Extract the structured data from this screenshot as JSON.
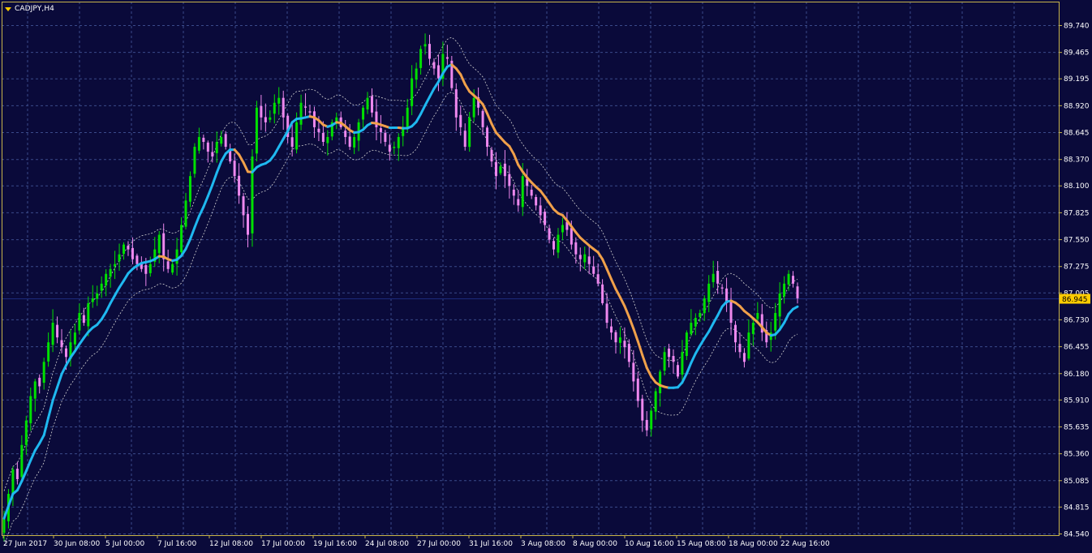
{
  "window": {
    "title": "CADJPY,H4",
    "menu_icon": "triangle-down-icon"
  },
  "colors": {
    "background": "#0a0a3a",
    "frame": "#c8b44a",
    "grid": "#3a4a8a",
    "text": "#ffffff",
    "bull_candle": "#00e000",
    "bear_candle": "#ee88ee",
    "ma_up": "#1fb8f0",
    "ma_down": "#f0a04a",
    "bands": "#d0d0d0",
    "price_line": "#1c2a7a",
    "price_tag_bg": "#ffcc00",
    "price_tag_text": "#000000"
  },
  "chart_data": {
    "type": "candlestick",
    "symbol": "CADJPY",
    "timeframe": "H4",
    "ylim": [
      84.54,
      89.74
    ],
    "y_ticks": [
      "89.740",
      "89.465",
      "89.195",
      "88.920",
      "88.645",
      "88.370",
      "88.100",
      "87.825",
      "87.550",
      "87.275",
      "87.005",
      "86.730",
      "86.455",
      "86.180",
      "85.910",
      "85.635",
      "85.360",
      "85.085",
      "84.815",
      "84.540"
    ],
    "x_ticks": [
      "27 Jun 2017",
      "30 Jun 08:00",
      "5 Jul 00:00",
      "7 Jul 16:00",
      "12 Jul 08:00",
      "17 Jul 00:00",
      "19 Jul 16:00",
      "24 Jul 08:00",
      "27 Jul 00:00",
      "31 Jul 16:00",
      "3 Aug 08:00",
      "8 Aug 00:00",
      "10 Aug 16:00",
      "15 Aug 08:00",
      "18 Aug 00:00",
      "22 Aug 16:00"
    ],
    "current_price": "86.945",
    "grid": true,
    "indicators": [
      "moving average (two-color)",
      "envelope bands (dotted)"
    ],
    "closes": [
      84.7,
      84.95,
      85.2,
      85.1,
      85.45,
      85.7,
      85.95,
      86.1,
      86.05,
      86.3,
      86.5,
      86.7,
      86.55,
      86.45,
      86.35,
      86.5,
      86.6,
      86.8,
      86.7,
      86.9,
      86.95,
      87.0,
      87.1,
      87.2,
      87.25,
      87.3,
      87.4,
      87.5,
      87.45,
      87.35,
      87.3,
      87.25,
      87.2,
      87.3,
      87.45,
      87.6,
      87.35,
      87.25,
      87.3,
      87.45,
      87.7,
      87.95,
      88.2,
      88.5,
      88.6,
      88.55,
      88.45,
      88.4,
      88.55,
      88.6,
      88.5,
      88.35,
      88.2,
      88.0,
      87.8,
      87.6,
      88.4,
      88.9,
      88.8,
      88.75,
      88.8,
      88.95,
      89.0,
      88.8,
      88.6,
      88.5,
      88.75,
      88.95,
      88.9,
      88.85,
      88.7,
      88.65,
      88.55,
      88.6,
      88.75,
      88.8,
      88.7,
      88.6,
      88.5,
      88.6,
      88.75,
      88.9,
      89.0,
      88.85,
      88.7,
      88.65,
      88.55,
      88.45,
      88.5,
      88.6,
      88.7,
      88.9,
      89.2,
      89.3,
      89.5,
      89.55,
      89.4,
      89.3,
      89.2,
      89.45,
      89.4,
      89.1,
      88.8,
      88.7,
      88.5,
      88.8,
      89.0,
      88.9,
      88.7,
      88.5,
      88.35,
      88.2,
      88.3,
      88.2,
      88.1,
      88.0,
      87.9,
      88.2,
      88.1,
      88.0,
      87.9,
      87.8,
      87.7,
      87.55,
      87.45,
      87.6,
      87.7,
      87.65,
      87.5,
      87.4,
      87.35,
      87.4,
      87.3,
      87.2,
      87.1,
      86.9,
      86.7,
      86.6,
      86.5,
      86.55,
      86.45,
      86.3,
      86.1,
      85.9,
      85.7,
      85.6,
      85.8,
      86.0,
      86.2,
      86.4,
      86.35,
      86.3,
      86.15,
      86.4,
      86.6,
      86.7,
      86.75,
      86.8,
      86.95,
      87.1,
      87.2,
      87.1,
      87.05,
      86.9,
      86.7,
      86.5,
      86.4,
      86.3,
      86.6,
      86.7,
      86.8,
      86.6,
      86.5,
      86.6,
      86.8,
      87.0,
      87.1,
      87.2,
      87.1,
      86.95
    ]
  }
}
